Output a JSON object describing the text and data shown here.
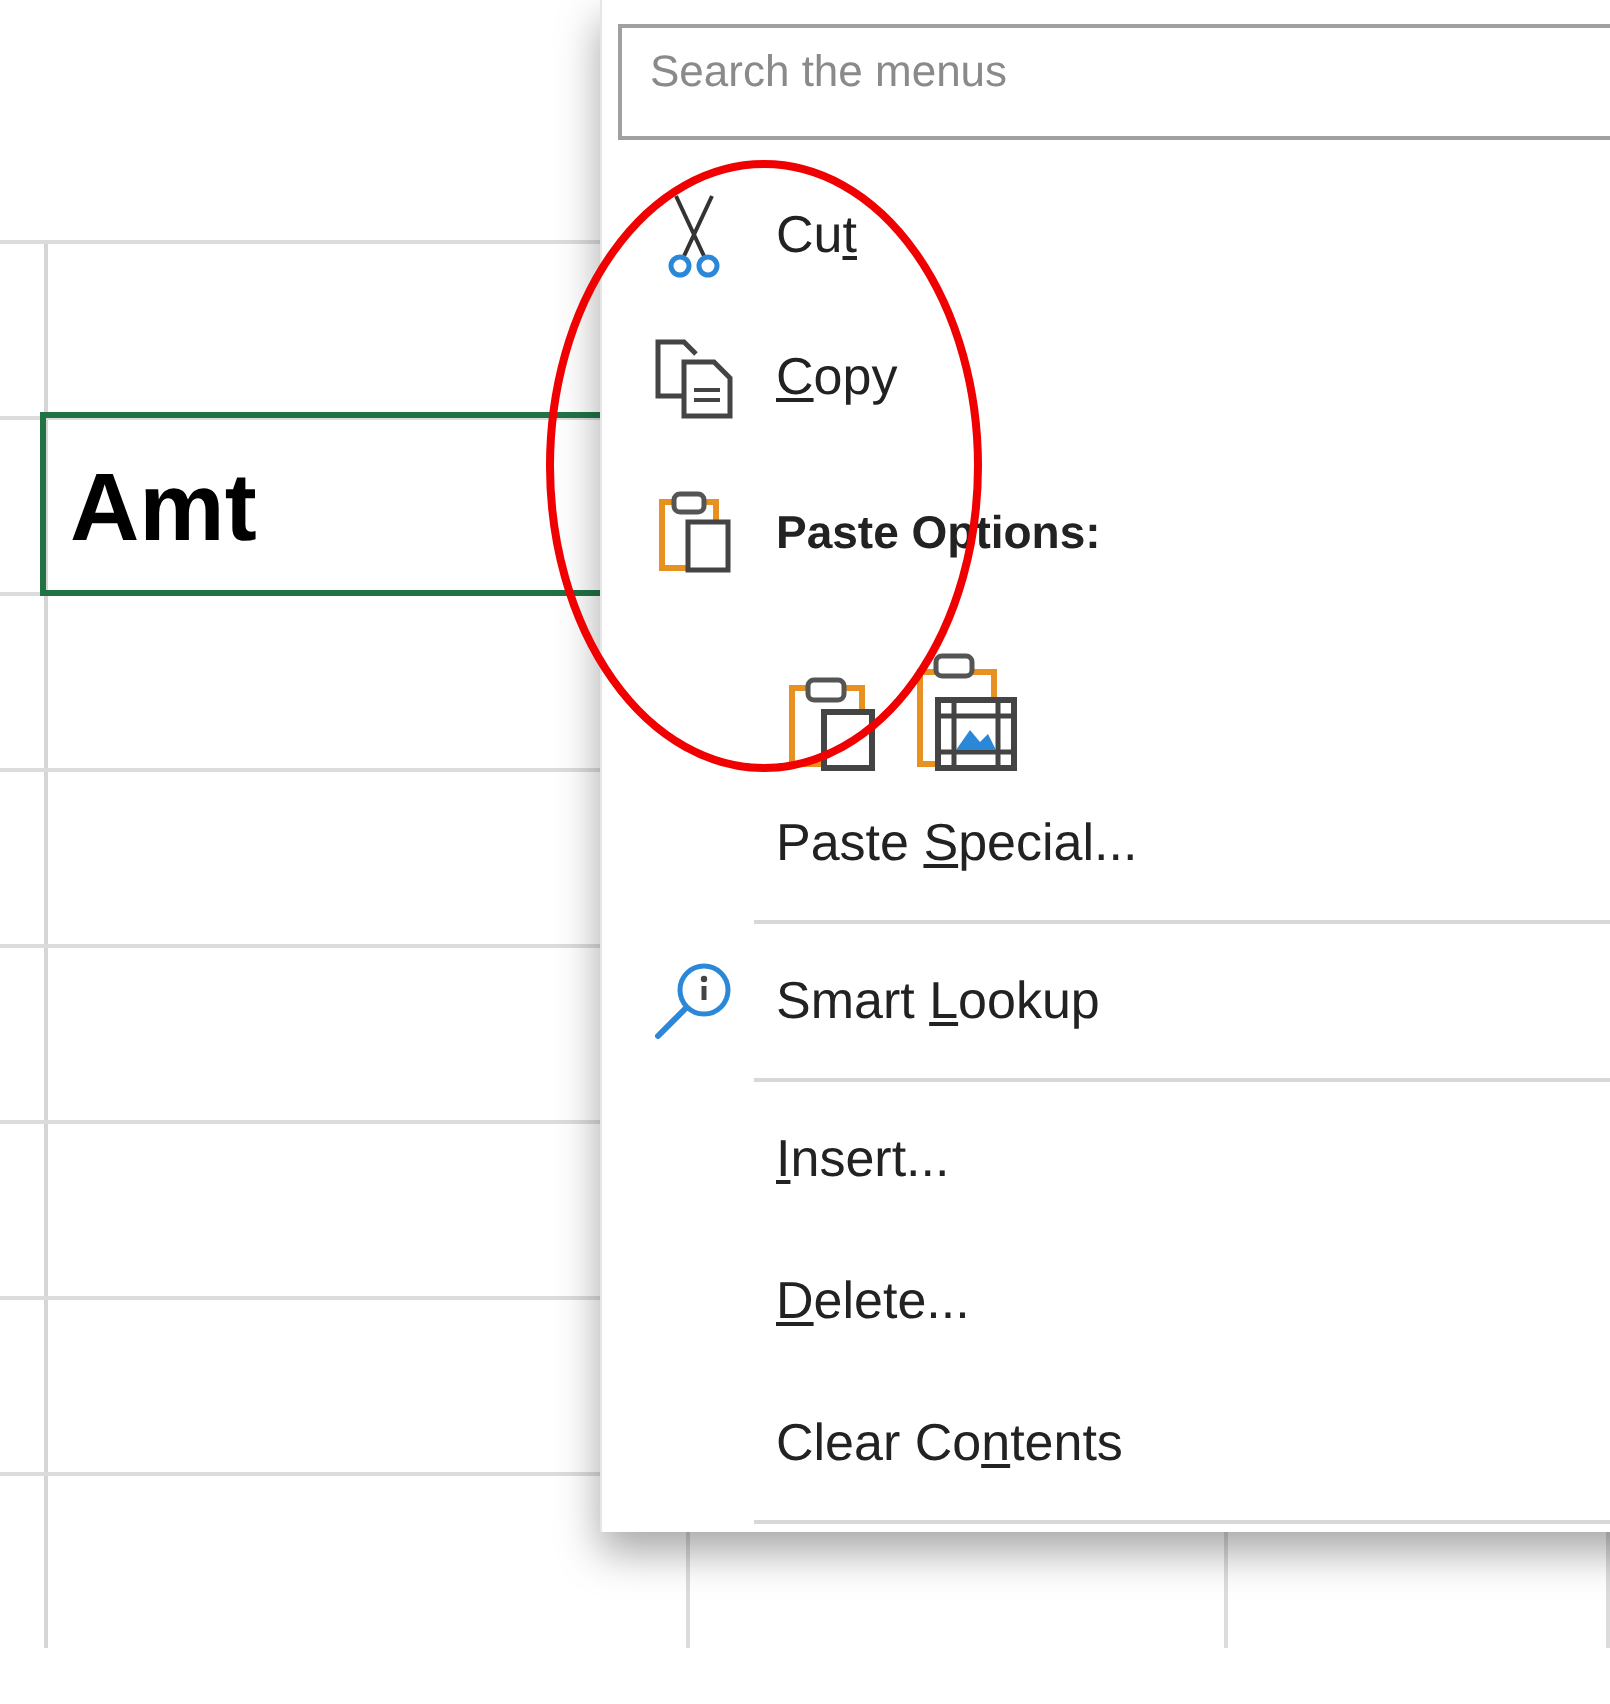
{
  "sheet": {
    "active_cell": {
      "value": "Amt",
      "selected": true
    }
  },
  "context_menu": {
    "search": {
      "placeholder": "Search the menus"
    },
    "items": [
      {
        "kind": "command",
        "label": {
          "pre": "Cu",
          "key": "t"
        }
      },
      {
        "kind": "command",
        "label": {
          "key": "C",
          "post": "opy"
        }
      },
      {
        "kind": "heading",
        "label": {
          "pre": "Paste Options:"
        }
      },
      {
        "kind": "paste-buttons"
      },
      {
        "kind": "command",
        "label": {
          "pre": "Paste ",
          "key": "S",
          "post": "pecial..."
        }
      },
      {
        "kind": "separator"
      },
      {
        "kind": "command",
        "label": {
          "pre": "Smart ",
          "key": "L",
          "post": "ookup"
        }
      },
      {
        "kind": "separator"
      },
      {
        "kind": "command",
        "label": {
          "key": "I",
          "post": "nsert..."
        }
      },
      {
        "kind": "command",
        "label": {
          "key": "D",
          "post": "elete..."
        }
      },
      {
        "kind": "command",
        "label": {
          "pre": "Clear Co",
          "key": "n",
          "post": "tents"
        }
      },
      {
        "kind": "separator"
      }
    ]
  },
  "annotations": [
    {
      "kind": "ellipse"
    }
  ]
}
